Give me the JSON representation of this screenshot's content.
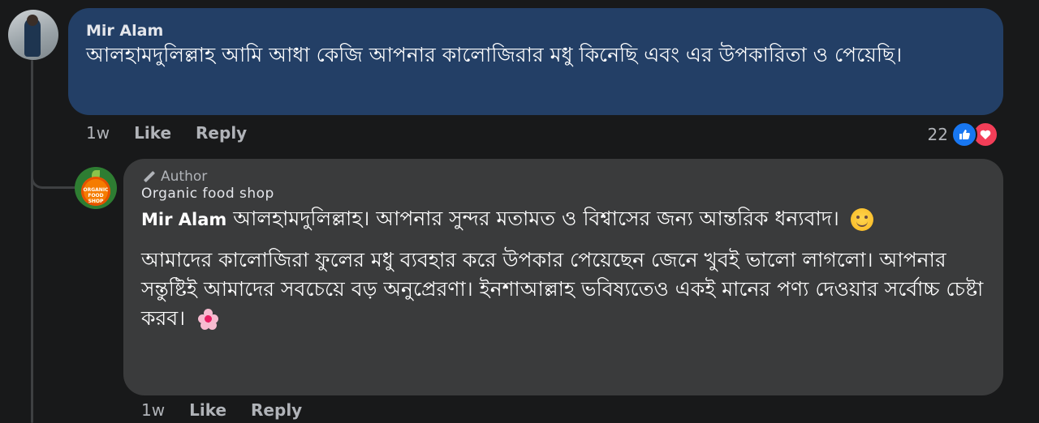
{
  "comment": {
    "author": "Mir Alam",
    "text": "আলহামদুলিল্লাহ আমি আধা কেজি আপনার কালোজিরার মধু কিনেছি এবং এর উপকারিতা ও পেয়েছি।",
    "time": "1w",
    "like_label": "Like",
    "reply_label": "Reply",
    "reaction_count": "22",
    "reactions": [
      "like-icon",
      "love-icon"
    ],
    "bubble_color": "#233f66"
  },
  "reply": {
    "badge": "Author",
    "author": "Organic food shop",
    "mention": "Mir Alam",
    "paragraph1": "আলহামদুলিল্লাহ। আপনার সুন্দর মতামত ও বিশ্বাসের জন্য আন্তরিক ধন্যবাদ।",
    "paragraph2": "আমাদের কালোজিরা ফুলের মধু ব্যবহার করে উপকার পেয়েছেন জেনে খুবই ভালো লাগলো। আপনার সন্তুষ্টিই আমাদের সবচেয়ে বড় অনুপ্রেরণা। ইনশাআল্লাহ ভবিষ্যতেও একই মানের পণ্য দেওয়ার সর্বোচ্চ চেষ্টা করব।",
    "time": "1w",
    "like_label": "Like",
    "reply_label": "Reply",
    "bubble_color": "#3a3b3c",
    "avatar_text": "ORGANIC FOOD SHOP"
  },
  "colors": {
    "background": "#18191a",
    "like_blue": "#1877f2",
    "love_red": "#f33e58"
  }
}
